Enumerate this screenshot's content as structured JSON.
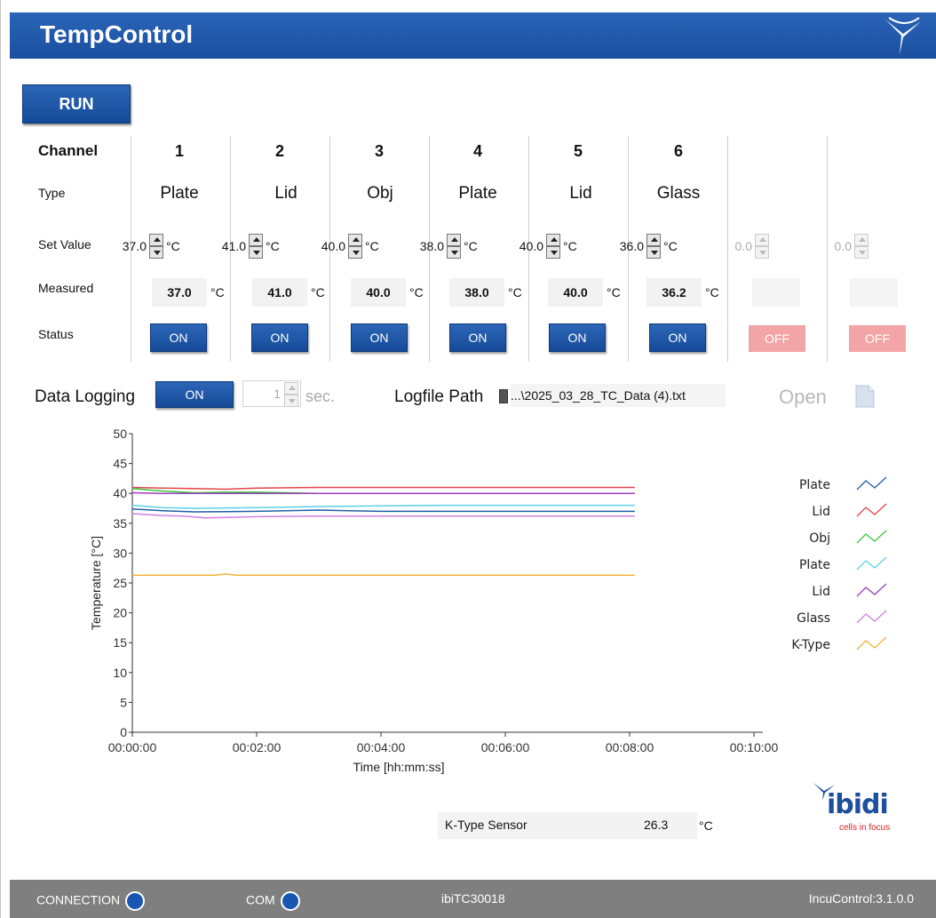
{
  "app": {
    "title": "TempControl"
  },
  "run_button": "RUN",
  "row_labels": {
    "channel": "Channel",
    "type": "Type",
    "set_value": "Set Value",
    "measured": "Measured",
    "status": "Status"
  },
  "unit": "°C",
  "channels": [
    {
      "number": "1",
      "type": "Plate",
      "set_value": "37.0",
      "measured": "37.0",
      "status": "ON"
    },
    {
      "number": "2",
      "type": "Lid",
      "set_value": "41.0",
      "measured": "41.0",
      "status": "ON"
    },
    {
      "number": "3",
      "type": "Obj",
      "set_value": "40.0",
      "measured": "40.0",
      "status": "ON"
    },
    {
      "number": "4",
      "type": "Plate",
      "set_value": "38.0",
      "measured": "38.0",
      "status": "ON"
    },
    {
      "number": "5",
      "type": "Lid",
      "set_value": "40.0",
      "measured": "40.0",
      "status": "ON"
    },
    {
      "number": "6",
      "type": "Glass",
      "set_value": "36.0",
      "measured": "36.2",
      "status": "ON"
    }
  ],
  "extra_channels": [
    {
      "set_value": "0.0",
      "status": "OFF"
    },
    {
      "set_value": "0.0",
      "status": "OFF"
    }
  ],
  "logging": {
    "label": "Data Logging",
    "toggle": "ON",
    "interval": "1",
    "interval_unit": "sec.",
    "path_label": "Logfile Path",
    "path_value": "...\\2025_03_28_TC_Data (4).txt",
    "open_label": "Open"
  },
  "chart_data": {
    "type": "line",
    "xlabel": "Time [hh:mm:ss]",
    "ylabel": "Temperature  [°C]",
    "x_ticks": [
      "00:00:00",
      "00:02:00",
      "00:04:00",
      "00:06:00",
      "00:08:00",
      "00:10:00"
    ],
    "y_ticks": [
      "0",
      "5",
      "10",
      "15",
      "20",
      "25",
      "30",
      "35",
      "40",
      "45",
      "50"
    ],
    "xlim_seconds": [
      0,
      600
    ],
    "ylim": [
      0,
      50
    ],
    "legend_position": "right",
    "series": [
      {
        "name": "Plate",
        "color": "#1f5fa6",
        "x": [
          0,
          30,
          60,
          120,
          180,
          240,
          300,
          360,
          420,
          485
        ],
        "y": [
          37.4,
          37.1,
          36.9,
          37.0,
          37.2,
          37.0,
          37.0,
          37.0,
          37.0,
          37.0
        ]
      },
      {
        "name": "Lid",
        "color": "#e0474c",
        "x": [
          0,
          30,
          60,
          90,
          120,
          180,
          240,
          300,
          360,
          420,
          485
        ],
        "y": [
          41.0,
          40.9,
          40.8,
          40.7,
          40.9,
          41.0,
          41.0,
          41.0,
          41.0,
          41.0,
          41.0
        ]
      },
      {
        "name": "Obj",
        "color": "#3cc63c",
        "x": [
          0,
          20,
          40,
          60,
          90,
          120,
          180,
          240,
          300,
          360,
          420,
          485
        ],
        "y": [
          40.8,
          40.5,
          40.3,
          40.1,
          40.2,
          40.2,
          40.0,
          40.0,
          40.0,
          40.0,
          40.0,
          40.0
        ]
      },
      {
        "name": "Plate",
        "color": "#5bd0e6",
        "x": [
          0,
          30,
          60,
          120,
          180,
          240,
          300,
          360,
          420,
          485
        ],
        "y": [
          38.0,
          37.6,
          37.5,
          37.6,
          37.8,
          37.9,
          38.0,
          38.0,
          38.0,
          38.0
        ]
      },
      {
        "name": "Lid",
        "color": "#9b3fc0",
        "x": [
          0,
          30,
          60,
          120,
          180,
          240,
          300,
          360,
          420,
          485
        ],
        "y": [
          40.1,
          40.0,
          40.0,
          40.0,
          40.0,
          40.0,
          40.0,
          40.0,
          40.0,
          40.0
        ]
      },
      {
        "name": "Glass",
        "color": "#d080e0",
        "x": [
          0,
          30,
          50,
          70,
          120,
          180,
          240,
          300,
          360,
          420,
          485
        ],
        "y": [
          36.6,
          36.3,
          36.2,
          35.9,
          36.1,
          36.2,
          36.2,
          36.2,
          36.2,
          36.2,
          36.2
        ]
      },
      {
        "name": "K-Type",
        "color": "#f2b33c",
        "x": [
          0,
          80,
          90,
          100,
          160,
          240,
          320,
          400,
          485
        ],
        "y": [
          26.3,
          26.3,
          26.5,
          26.3,
          26.3,
          26.3,
          26.3,
          26.3,
          26.3
        ]
      }
    ]
  },
  "ktype": {
    "label": "K-Type Sensor",
    "value": "26.3",
    "unit": "°C"
  },
  "brand": {
    "name": "ibidi",
    "tagline": "cells in focus"
  },
  "statusbar": {
    "connection": "CONNECTION",
    "com": "COM",
    "device": "ibiTC30018",
    "version": "IncuControl:3.1.0.0"
  }
}
